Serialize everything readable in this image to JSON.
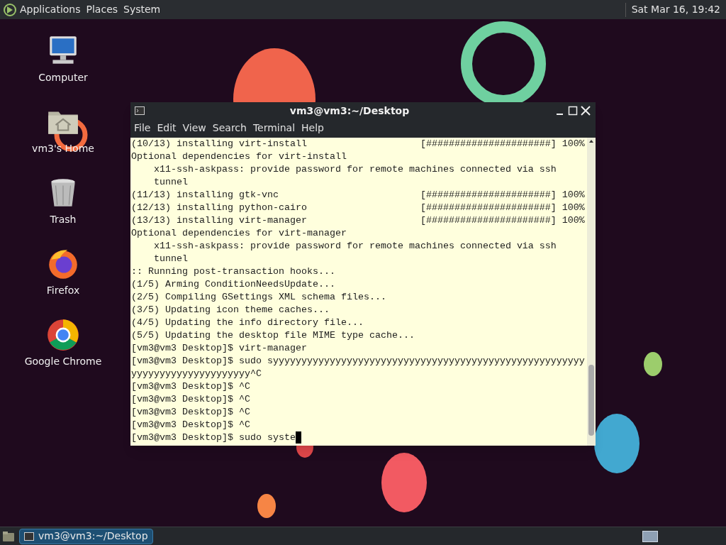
{
  "top_panel": {
    "menus": [
      "Applications",
      "Places",
      "System"
    ],
    "clock": "Sat Mar 16, 19:42"
  },
  "desktop_icons": [
    {
      "kind": "computer",
      "label": "Computer"
    },
    {
      "kind": "home",
      "label": "vm3's Home"
    },
    {
      "kind": "trash",
      "label": "Trash"
    },
    {
      "kind": "firefox",
      "label": "Firefox"
    },
    {
      "kind": "chrome",
      "label": "Google Chrome"
    }
  ],
  "terminal": {
    "title": "vm3@vm3:~/Desktop",
    "menu": [
      "File",
      "Edit",
      "View",
      "Search",
      "Terminal",
      "Help"
    ],
    "lines": [
      "(10/13) installing virt-install                    [######################] 100%",
      "Optional dependencies for virt-install",
      "    x11-ssh-askpass: provide password for remote machines connected via ssh",
      "    tunnel",
      "(11/13) installing gtk-vnc                         [######################] 100%",
      "(12/13) installing python-cairo                    [######################] 100%",
      "(13/13) installing virt-manager                    [######################] 100%",
      "Optional dependencies for virt-manager",
      "    x11-ssh-askpass: provide password for remote machines connected via ssh",
      "    tunnel",
      ":: Running post-transaction hooks...",
      "(1/5) Arming ConditionNeedsUpdate...",
      "(2/5) Compiling GSettings XML schema files...",
      "(3/5) Updating icon theme caches...",
      "(4/5) Updating the info directory file...",
      "(5/5) Updating the desktop file MIME type cache...",
      "[vm3@vm3 Desktop]$ virt-manager",
      "[vm3@vm3 Desktop]$ sudo syyyyyyyyyyyyyyyyyyyyyyyyyyyyyyyyyyyyyyyyyyyyyyyyyyyyyyy",
      "yyyyyyyyyyyyyyyyyyyyy^C",
      "[vm3@vm3 Desktop]$ ^C",
      "[vm3@vm3 Desktop]$ ^C",
      "[vm3@vm3 Desktop]$ ^C",
      "[vm3@vm3 Desktop]$ ^C",
      "[vm3@vm3 Desktop]$ sudo syste"
    ]
  },
  "taskbar": {
    "tasks": [
      {
        "label": "vm3@vm3:~/Desktop",
        "selected": true
      }
    ]
  }
}
